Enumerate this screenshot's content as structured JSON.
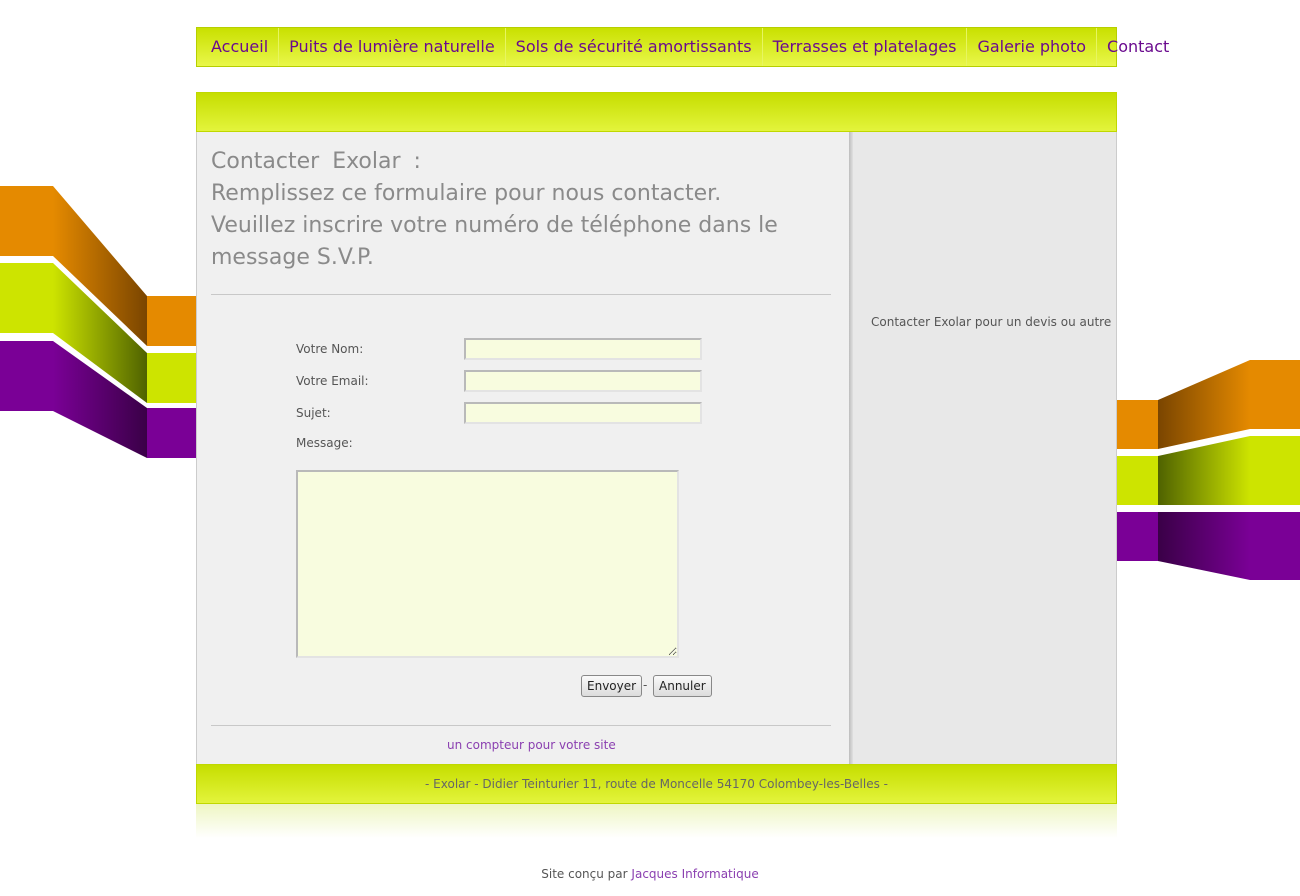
{
  "colors": {
    "nav_text": "#6a0a8e",
    "lime": "#cde400",
    "orange": "#e58a00",
    "purple": "#7a0096",
    "link": "#8a3fb0"
  },
  "nav": {
    "items": [
      {
        "label": "Accueil"
      },
      {
        "label": "Puits de lumière naturelle"
      },
      {
        "label": "Sols de sécurité amortissants"
      },
      {
        "label": "Terrasses et platelages"
      },
      {
        "label": "Galerie photo"
      },
      {
        "label": "Contact"
      }
    ]
  },
  "page": {
    "title_prefix": "Contacter",
    "company": "Exolar",
    "colon": ":",
    "subtitle_1": "Remplissez ce formulaire pour nous contacter.",
    "subtitle_2": "Veuillez inscrire votre numéro de téléphone dans le message S.V.P."
  },
  "form": {
    "name_label": "Votre Nom:",
    "email_label": "Votre Email:",
    "subject_label": "Sujet:",
    "message_label": "Message:",
    "name_value": "",
    "email_value": "",
    "subject_value": "",
    "message_value": "",
    "send_button": "Envoyer",
    "separator": "-",
    "cancel_button": "Annuler"
  },
  "counter_link": "un compteur pour votre site",
  "sidebar": {
    "text": "Contacter Exolar pour un devis ou autre"
  },
  "footer": {
    "address": "- Exolar - Didier Teinturier 11, route de Moncelle 54170 Colombey-les-Belles -"
  },
  "credit": {
    "prefix": "Site conçu par",
    "link": "Jacques Informatique"
  }
}
